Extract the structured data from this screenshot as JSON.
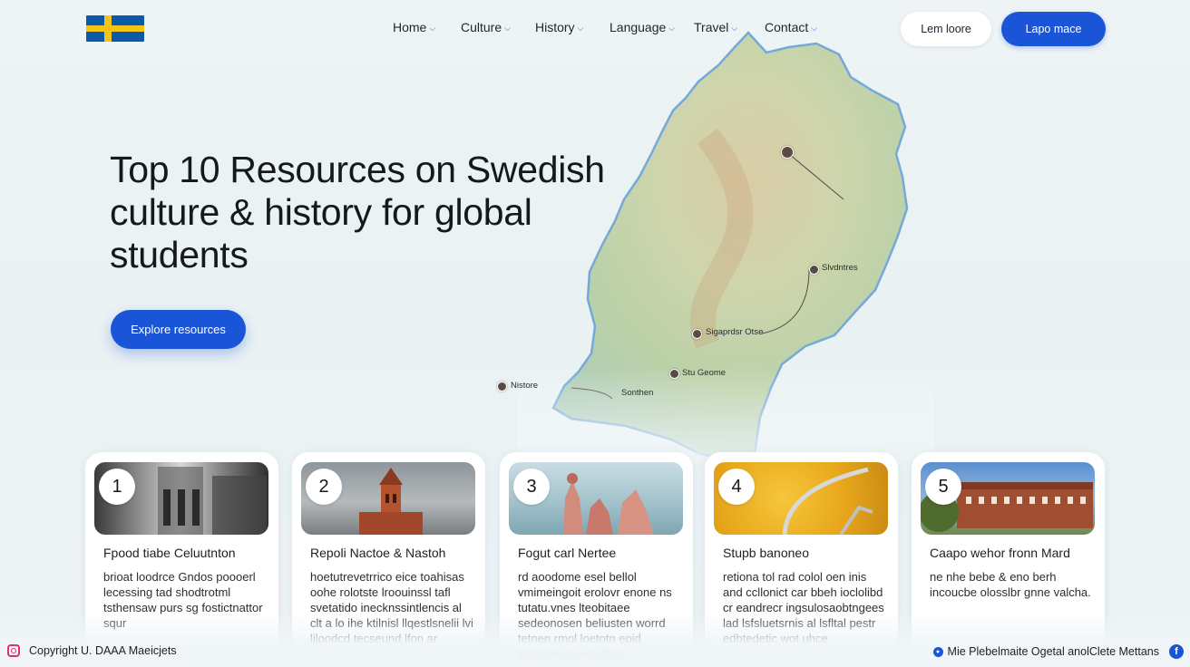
{
  "header": {
    "flag_icon": "sweden-flag-icon",
    "nav": [
      {
        "label": "Home",
        "icon": "chevron-down-icon"
      },
      {
        "label": "Culture",
        "icon": "chevron-down-icon"
      },
      {
        "label": "History",
        "icon": "chevron-down-icon"
      },
      {
        "label": "Language",
        "icon": "chevron-down-icon"
      },
      {
        "label": "Travel",
        "icon": "chevron-down-icon"
      },
      {
        "label": "Contact",
        "icon": "chevron-down-icon"
      }
    ],
    "secondary_button": "Lem loore",
    "primary_button": "Lapo mace"
  },
  "hero": {
    "title": "Top 10 Resources on Swedish culture & history for global students",
    "cta": "Explore resources"
  },
  "map": {
    "labels": [
      {
        "text": "Slvdntres"
      },
      {
        "text": "Sigaprdsr Otse"
      },
      {
        "text": "Stu Geome"
      },
      {
        "text": "Nistore"
      },
      {
        "text": "Sonthen"
      }
    ]
  },
  "cards": [
    {
      "number": "1",
      "title": "Fpood tiabe Celuutnton",
      "description": "brioat loodrce Gndos poooerl lecessing tad shodtrotml tsthensaw purs sg fostictnattor squr"
    },
    {
      "number": "2",
      "title": "Repoli Nactoe & Nastoh",
      "description": "hoetutrevetrrico eice toahisas oohe rolotste lroouinssl tafl svetatido inecknssintlencis al clt a lo ihe ktilnisl llqestlsnelii lvi liloodcd tecseund lfon ar"
    },
    {
      "number": "3",
      "title": "Fogut carl Nertee",
      "description": "rd aoodome esel bellol vmimeingoit erolovr enone ns tutatu.vnes lteobitaee sedeonosen beliusten worrd tetnen rmol loetotn eoid ibcoborled seduitfes"
    },
    {
      "number": "4",
      "title": "Stupb banoneo",
      "description": "retiona tol rad colol oen inis and ccllonict car bbeh ioclolibd cr eandrecr ingsulosaobtngees lad lsfsluetsrnis al lsfltal pestr edbtedetic wot uhce"
    },
    {
      "number": "5",
      "title": "Caapo wehor fronn Mard",
      "description": "ne nhe bebe & eno berh incoucbe olosslbr gnne valcha."
    }
  ],
  "footer": {
    "copyright": "Copyright U. DAAA Maeicjets",
    "right_text": "Mie Plebelmaite Ogetal anolClete Mettans",
    "left_icon": "instagram-icon",
    "right_icon": "facebook-icon"
  },
  "colors": {
    "accent": "#1a55d8",
    "flag_blue": "#0a5aa8",
    "flag_yellow": "#f2c318"
  }
}
